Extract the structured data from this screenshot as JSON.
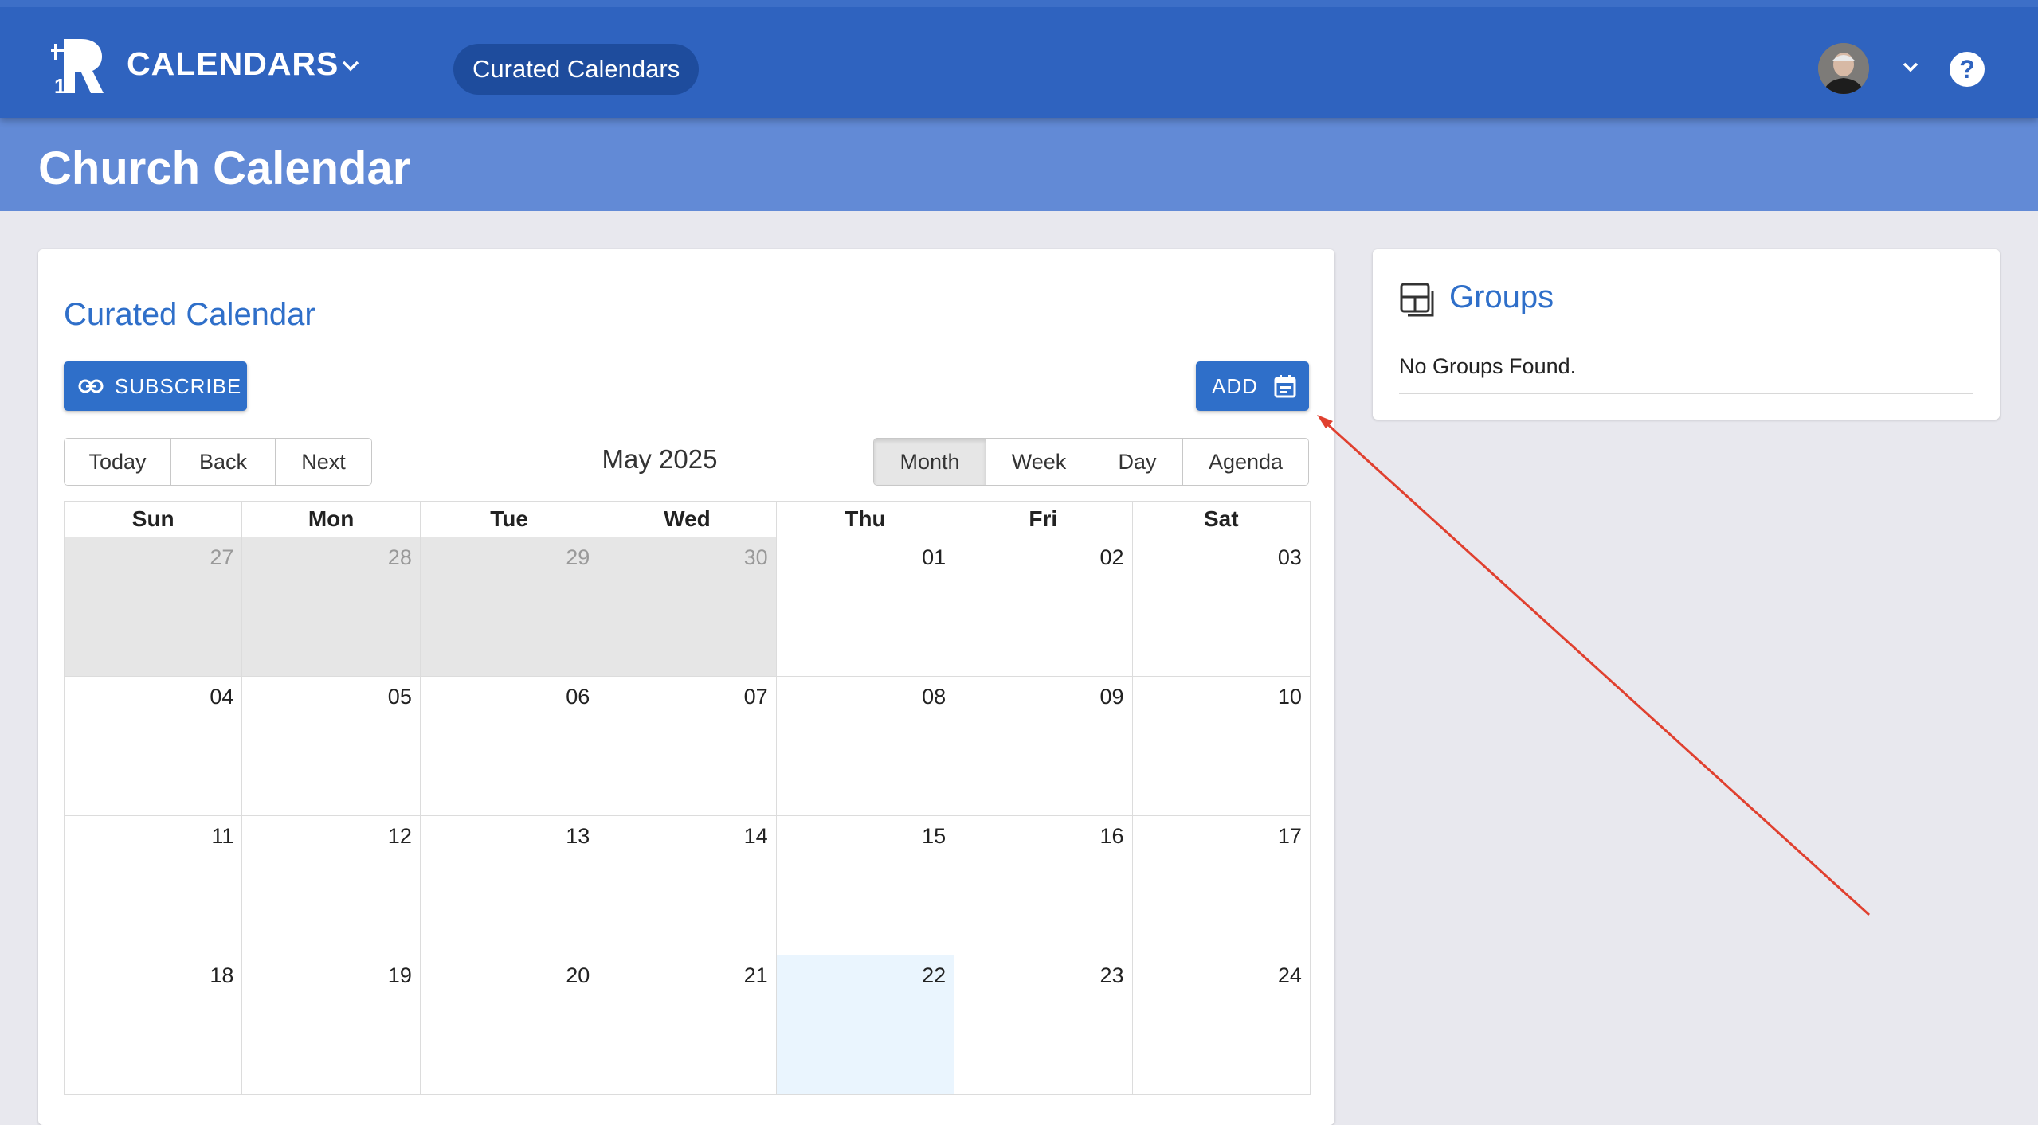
{
  "appbar": {
    "title": "CALENDARS",
    "curated_link": "Curated Calendars",
    "brand_color": "#2f63bf"
  },
  "page": {
    "title": "Church Calendar"
  },
  "calendar_card": {
    "title": "Curated Calendar",
    "subscribe_label": "SUBSCRIBE",
    "add_label": "ADD",
    "nav_buttons": [
      "Today",
      "Back",
      "Next"
    ],
    "month_label": "May 2025",
    "view_buttons": [
      "Month",
      "Week",
      "Day",
      "Agenda"
    ],
    "active_view": "Month",
    "weekdays": [
      "Sun",
      "Mon",
      "Tue",
      "Wed",
      "Thu",
      "Fri",
      "Sat"
    ],
    "weeks": [
      [
        "27",
        "28",
        "29",
        "30",
        "01",
        "02",
        "03"
      ],
      [
        "04",
        "05",
        "06",
        "07",
        "08",
        "09",
        "10"
      ],
      [
        "11",
        "12",
        "13",
        "14",
        "15",
        "16",
        "17"
      ],
      [
        "18",
        "19",
        "20",
        "21",
        "22",
        "23",
        "24"
      ]
    ],
    "out_of_month_days": [
      "27",
      "28",
      "29",
      "30"
    ],
    "today": "22"
  },
  "groups_card": {
    "title": "Groups",
    "empty_text": "No Groups Found."
  },
  "annotation": {
    "color": "#e0402f"
  }
}
